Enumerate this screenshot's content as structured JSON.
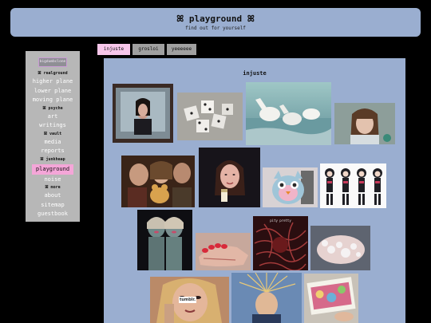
{
  "header": {
    "title": "ꕤ playground ꕤ",
    "subtitle": "find out for yourself"
  },
  "sidebar": {
    "logo_text": "bigdumbclone",
    "items": [
      {
        "type": "head",
        "label": "ꕤ realground"
      },
      {
        "type": "link",
        "label": "higher plane"
      },
      {
        "type": "link",
        "label": "lower plane"
      },
      {
        "type": "link",
        "label": "moving plane"
      },
      {
        "type": "head",
        "label": "ꕤ psyche"
      },
      {
        "type": "link",
        "label": "art"
      },
      {
        "type": "link",
        "label": "writings"
      },
      {
        "type": "head",
        "label": "ꕤ vault"
      },
      {
        "type": "link",
        "label": "media"
      },
      {
        "type": "link",
        "label": "reports"
      },
      {
        "type": "head",
        "label": "ꕤ junkheap"
      },
      {
        "type": "link",
        "label": "playground",
        "active": true
      },
      {
        "type": "link",
        "label": "noise"
      },
      {
        "type": "head",
        "label": "ꕤ more"
      },
      {
        "type": "link",
        "label": "about"
      },
      {
        "type": "link",
        "label": "sitemap"
      },
      {
        "type": "link",
        "label": "guestbook"
      }
    ]
  },
  "tabs": [
    {
      "label": "injuste",
      "active": true
    },
    {
      "label": "grosloi",
      "active": false
    },
    {
      "label": "yeeeeee",
      "active": false
    }
  ],
  "panel": {
    "title": "injuste",
    "images": [
      {
        "name": "thumb-girl-on-tv",
        "icon": "tv-screen"
      },
      {
        "name": "thumb-dice",
        "icon": "dice"
      },
      {
        "name": "thumb-white-horses",
        "icon": "horses"
      },
      {
        "name": "thumb-girl-bangs",
        "icon": "portrait"
      },
      {
        "name": "thumb-kids-teddy",
        "icon": "photo"
      },
      {
        "name": "thumb-woman-portrait",
        "icon": "portrait"
      },
      {
        "name": "thumb-furby",
        "icon": "toy"
      },
      {
        "name": "thumb-anime-girls",
        "icon": "drawing"
      },
      {
        "name": "thumb-painted-twins",
        "icon": "photo"
      },
      {
        "name": "thumb-painted-nails",
        "icon": "hand"
      },
      {
        "name": "thumb-album-cover",
        "icon": "album"
      },
      {
        "name": "thumb-soapy-hands",
        "icon": "hand"
      },
      {
        "name": "thumb-crying-girl",
        "icon": "portrait"
      },
      {
        "name": "thumb-static-hair",
        "icon": "portrait"
      },
      {
        "name": "thumb-picture-book",
        "icon": "book"
      }
    ],
    "tumblr_label": "tumblr.",
    "album_label": "pity pretty"
  }
}
